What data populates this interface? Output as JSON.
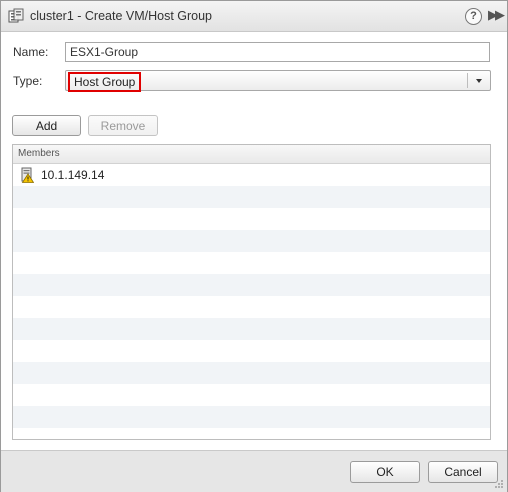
{
  "dialog": {
    "title": "cluster1 - Create VM/Host Group",
    "icons": {
      "title": "cluster-icon",
      "help": "help-icon",
      "expand": "expand-icon"
    },
    "help_glyph": "?",
    "expand_glyph": "▶▶"
  },
  "form": {
    "name_label": "Name:",
    "name_value": "ESX1-Group",
    "type_label": "Type:",
    "type_value": "Host Group"
  },
  "toolbar": {
    "add_label": "Add",
    "remove_label": "Remove"
  },
  "members": {
    "header": "Members",
    "items": [
      {
        "name": "10.1.149.14",
        "icon": "host-warning-icon"
      }
    ]
  },
  "footer": {
    "ok_label": "OK",
    "cancel_label": "Cancel"
  },
  "colors": {
    "highlight": "#e00000",
    "alt_row": "#f1f4f7",
    "footer_bg": "#e6e6e6"
  }
}
